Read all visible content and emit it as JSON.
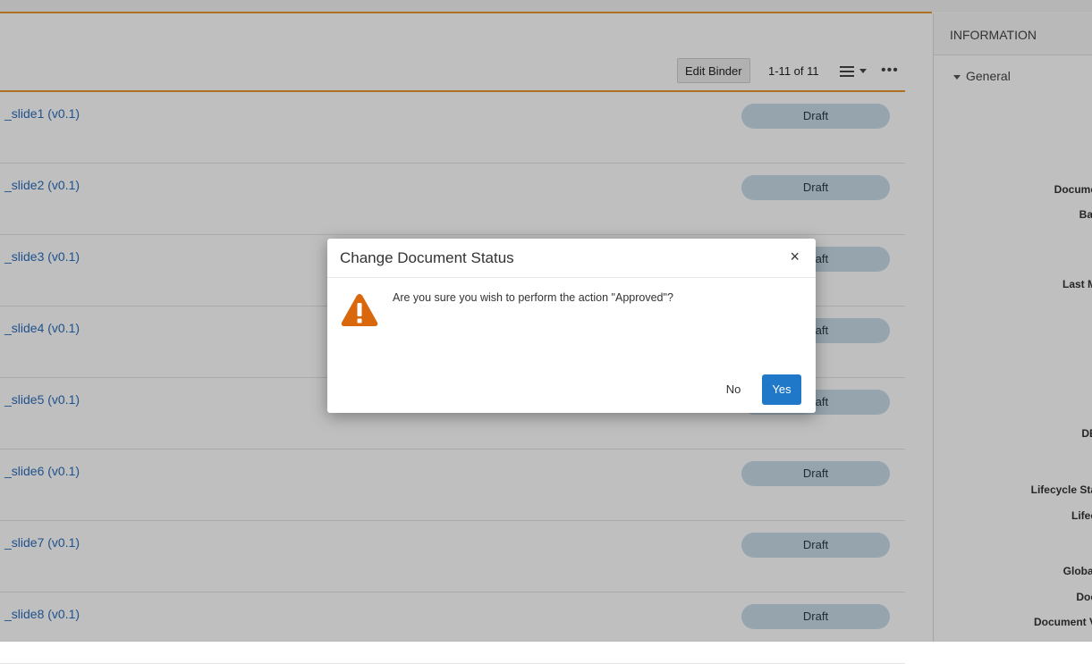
{
  "toolbar": {
    "edit_binder_label": "Edit Binder",
    "count_text": "1-11 of 11",
    "view_icon": "list-view-icon",
    "more_icon": "more-horizontal-icon"
  },
  "documents": [
    {
      "name": "_slide1 (v0.1)",
      "status": "Draft"
    },
    {
      "name": "_slide2 (v0.1)",
      "status": "Draft"
    },
    {
      "name": "_slide3 (v0.1)",
      "status": "Draft"
    },
    {
      "name": "_slide4 (v0.1)",
      "status": "Draft"
    },
    {
      "name": "_slide5 (v0.1)",
      "status": "Draft"
    },
    {
      "name": "_slide6 (v0.1)",
      "status": "Draft"
    },
    {
      "name": "_slide7 (v0.1)",
      "status": "Draft"
    },
    {
      "name": "_slide8 (v0.1)",
      "status": "Draft"
    }
  ],
  "info_panel": {
    "title": "INFORMATION",
    "section": "General",
    "field_labels": [
      "Docume",
      "Bat",
      "(",
      "Last M",
      "DE",
      "Lifecycle Sta",
      "Lifec",
      "Global",
      "Doc",
      "Document V"
    ]
  },
  "modal": {
    "title": "Change Document Status",
    "close_label": "×",
    "message": "Are you sure you wish to perform the action \"Approved\"?",
    "no_label": "No",
    "yes_label": "Yes"
  },
  "colors": {
    "accent": "#e8962e",
    "primary": "#1f78c8",
    "status_pill": "#c9dbe8",
    "warning": "#d9670c"
  }
}
